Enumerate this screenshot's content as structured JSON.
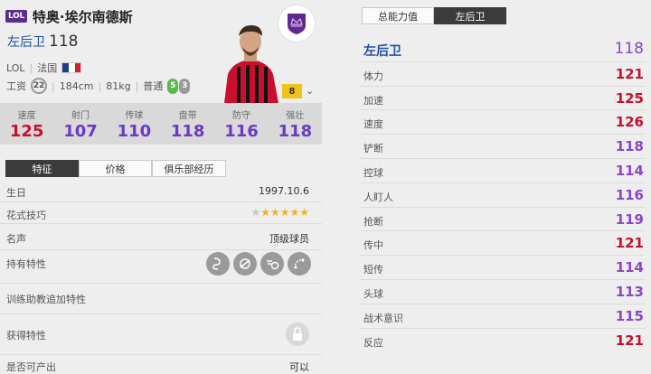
{
  "player": {
    "season_badge": "LOL",
    "name": "特奥·埃尔南德斯",
    "position": "左后卫",
    "ovr": "118",
    "league_tag": "LOL",
    "nation": "法国",
    "wage": "22",
    "height": "184cm",
    "weight": "81kg",
    "body": "普通",
    "weak_foot_left": "5",
    "weak_foot_right": "3",
    "level": "8"
  },
  "labels": {
    "wage_label": "工资",
    "sep": "|"
  },
  "stats": [
    {
      "label": "速度",
      "value": "125",
      "color": "#c8102e"
    },
    {
      "label": "射门",
      "value": "107",
      "color": "#6b39c4"
    },
    {
      "label": "传球",
      "value": "110",
      "color": "#6b39c4"
    },
    {
      "label": "盘带",
      "value": "118",
      "color": "#6b39c4"
    },
    {
      "label": "防守",
      "value": "116",
      "color": "#6b39c4"
    },
    {
      "label": "强壮",
      "value": "118",
      "color": "#6b39c4"
    }
  ],
  "tabs": [
    {
      "label": "特征",
      "active": true
    },
    {
      "label": "价格",
      "active": false
    },
    {
      "label": "俱乐部经历",
      "active": false
    }
  ],
  "details": {
    "birthday_label": "生日",
    "birthday": "1997.10.6",
    "skill_label": "花式技巧",
    "skill_stars": "★★★★★★",
    "fame_label": "名声",
    "fame": "顶级球员",
    "traits_label": "持有特性",
    "trainer_label": "训练助教追加特性",
    "acquired_label": "获得特性",
    "tradable_label": "是否可产出",
    "tradable": "可以"
  },
  "right_tabs": [
    {
      "label": "总能力值",
      "active": false
    },
    {
      "label": "左后卫",
      "active": true
    }
  ],
  "attributes": [
    {
      "name": "左后卫",
      "value": "118",
      "color": "#8a47c9",
      "head": true
    },
    {
      "name": "体力",
      "value": "121",
      "color": "#c8102e"
    },
    {
      "name": "加速",
      "value": "125",
      "color": "#c8102e"
    },
    {
      "name": "速度",
      "value": "126",
      "color": "#c8102e"
    },
    {
      "name": "铲断",
      "value": "118",
      "color": "#8a47c9"
    },
    {
      "name": "控球",
      "value": "114",
      "color": "#8a47c9"
    },
    {
      "name": "人盯人",
      "value": "116",
      "color": "#8a47c9"
    },
    {
      "name": "抢断",
      "value": "119",
      "color": "#8a47c9"
    },
    {
      "name": "传中",
      "value": "121",
      "color": "#c8102e"
    },
    {
      "name": "短传",
      "value": "114",
      "color": "#8a47c9"
    },
    {
      "name": "头球",
      "value": "113",
      "color": "#8a47c9"
    },
    {
      "name": "战术意识",
      "value": "115",
      "color": "#8a47c9"
    },
    {
      "name": "反应",
      "value": "121",
      "color": "#c8102e"
    }
  ],
  "icons": {
    "club": "crown-shield-icon",
    "lock": "lock-icon",
    "traits": [
      "snake-dribble-icon",
      "long-throw-icon",
      "ball-runner-icon",
      "playmaker-icon"
    ]
  }
}
